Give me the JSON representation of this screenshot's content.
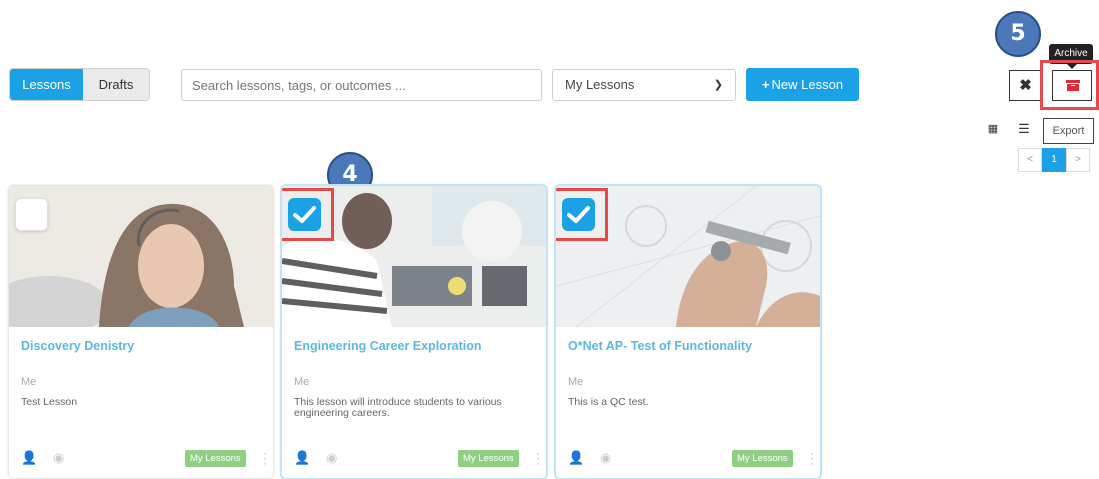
{
  "tabs": [
    {
      "label": "Lessons",
      "active": true
    },
    {
      "label": "Drafts",
      "active": false
    }
  ],
  "search": {
    "placeholder": "Search lessons, tags, or outcomes ..."
  },
  "filter": {
    "selected": "My Lessons"
  },
  "new_lesson_label": "New Lesson",
  "steps": {
    "four": "4",
    "five": "5"
  },
  "tooltip": "Archive",
  "close_symbol": "✖",
  "view": {
    "grid_icon": "grid-icon",
    "list_icon": "list-icon"
  },
  "export_label": "Export",
  "pagination": {
    "prev": "<",
    "current": "1",
    "next": ">"
  },
  "cards": [
    {
      "title": "Discovery Denistry",
      "author": "Me",
      "description": "Test Lesson",
      "badge": "My Lessons",
      "selected": false
    },
    {
      "title": "Engineering Career Exploration",
      "author": "Me",
      "description": "This lesson will introduce students to various engineering careers.",
      "badge": "My Lessons",
      "selected": true
    },
    {
      "title": "O*Net AP- Test of Functionality",
      "author": "Me",
      "description": "This is a QC test.",
      "badge": "My Lessons",
      "selected": true
    }
  ],
  "colors": {
    "accent": "#1ba1e6",
    "badge": "#8fcf82",
    "highlight": "#e34a4a",
    "step": "#4a78b8"
  }
}
